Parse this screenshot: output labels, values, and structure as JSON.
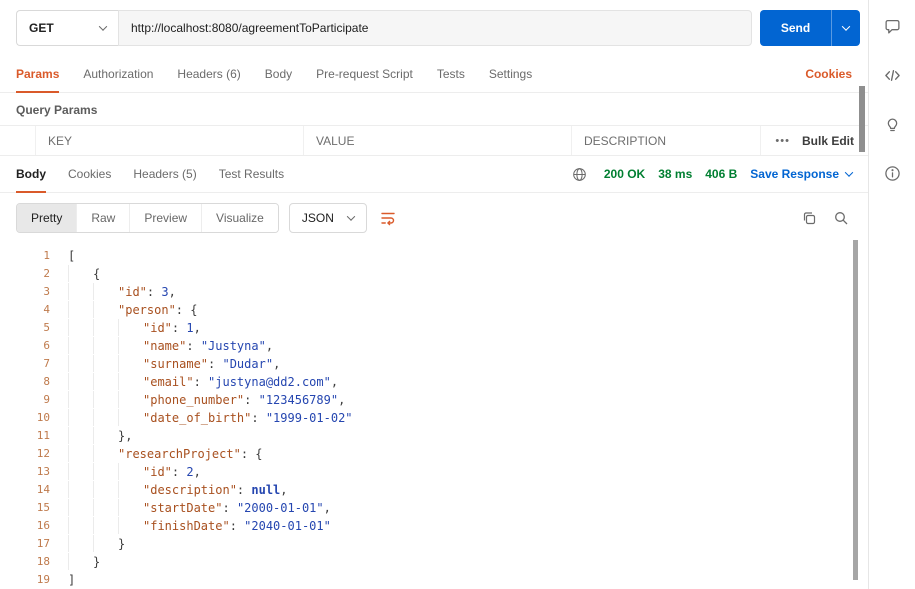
{
  "request": {
    "method": "GET",
    "url": "http://localhost:8080/agreementToParticipate",
    "send_label": "Send"
  },
  "request_tabs": [
    {
      "label": "Params",
      "active": true
    },
    {
      "label": "Authorization",
      "active": false
    },
    {
      "label": "Headers (6)",
      "active": false
    },
    {
      "label": "Body",
      "active": false
    },
    {
      "label": "Pre-request Script",
      "active": false
    },
    {
      "label": "Tests",
      "active": false
    },
    {
      "label": "Settings",
      "active": false
    }
  ],
  "cookies_link": "Cookies",
  "query_params": {
    "title": "Query Params",
    "columns": [
      "KEY",
      "VALUE",
      "DESCRIPTION"
    ],
    "more_label": "•••",
    "bulk_edit_label": "Bulk Edit"
  },
  "response": {
    "tabs": [
      {
        "label": "Body",
        "active": true
      },
      {
        "label": "Cookies",
        "active": false
      },
      {
        "label": "Headers (5)",
        "active": false
      },
      {
        "label": "Test Results",
        "active": false
      }
    ],
    "status": "200 OK",
    "time": "38 ms",
    "size": "406 B",
    "save_response_label": "Save Response",
    "view_tabs": [
      {
        "label": "Pretty",
        "active": true
      },
      {
        "label": "Raw",
        "active": false
      },
      {
        "label": "Preview",
        "active": false
      },
      {
        "label": "Visualize",
        "active": false
      }
    ],
    "format": "JSON",
    "code": {
      "lines": [
        {
          "n": 1,
          "indent": 0,
          "tokens": [
            [
              "p",
              "["
            ]
          ]
        },
        {
          "n": 2,
          "indent": 1,
          "tokens": [
            [
              "p",
              "{"
            ]
          ]
        },
        {
          "n": 3,
          "indent": 2,
          "tokens": [
            [
              "k",
              "\"id\""
            ],
            [
              "p",
              ": "
            ],
            [
              "v",
              "3"
            ],
            [
              "p",
              ","
            ]
          ]
        },
        {
          "n": 4,
          "indent": 2,
          "tokens": [
            [
              "k",
              "\"person\""
            ],
            [
              "p",
              ": {"
            ]
          ]
        },
        {
          "n": 5,
          "indent": 3,
          "tokens": [
            [
              "k",
              "\"id\""
            ],
            [
              "p",
              ": "
            ],
            [
              "v",
              "1"
            ],
            [
              "p",
              ","
            ]
          ]
        },
        {
          "n": 6,
          "indent": 3,
          "tokens": [
            [
              "k",
              "\"name\""
            ],
            [
              "p",
              ": "
            ],
            [
              "s",
              "\"Justyna\""
            ],
            [
              "p",
              ","
            ]
          ]
        },
        {
          "n": 7,
          "indent": 3,
          "tokens": [
            [
              "k",
              "\"surname\""
            ],
            [
              "p",
              ": "
            ],
            [
              "s",
              "\"Dudar\""
            ],
            [
              "p",
              ","
            ]
          ]
        },
        {
          "n": 8,
          "indent": 3,
          "tokens": [
            [
              "k",
              "\"email\""
            ],
            [
              "p",
              ": "
            ],
            [
              "s",
              "\"justyna@dd2.com\""
            ],
            [
              "p",
              ","
            ]
          ]
        },
        {
          "n": 9,
          "indent": 3,
          "tokens": [
            [
              "k",
              "\"phone_number\""
            ],
            [
              "p",
              ": "
            ],
            [
              "s",
              "\"123456789\""
            ],
            [
              "p",
              ","
            ]
          ]
        },
        {
          "n": 10,
          "indent": 3,
          "tokens": [
            [
              "k",
              "\"date_of_birth\""
            ],
            [
              "p",
              ": "
            ],
            [
              "s",
              "\"1999-01-02\""
            ]
          ]
        },
        {
          "n": 11,
          "indent": 2,
          "tokens": [
            [
              "p",
              "},"
            ]
          ]
        },
        {
          "n": 12,
          "indent": 2,
          "tokens": [
            [
              "k",
              "\"researchProject\""
            ],
            [
              "p",
              ": {"
            ]
          ]
        },
        {
          "n": 13,
          "indent": 3,
          "tokens": [
            [
              "k",
              "\"id\""
            ],
            [
              "p",
              ": "
            ],
            [
              "v",
              "2"
            ],
            [
              "p",
              ","
            ]
          ]
        },
        {
          "n": 14,
          "indent": 3,
          "tokens": [
            [
              "k",
              "\"description\""
            ],
            [
              "p",
              ": "
            ],
            [
              "n",
              "null"
            ],
            [
              "p",
              ","
            ]
          ]
        },
        {
          "n": 15,
          "indent": 3,
          "tokens": [
            [
              "k",
              "\"startDate\""
            ],
            [
              "p",
              ": "
            ],
            [
              "s",
              "\"2000-01-01\""
            ],
            [
              "p",
              ","
            ]
          ]
        },
        {
          "n": 16,
          "indent": 3,
          "tokens": [
            [
              "k",
              "\"finishDate\""
            ],
            [
              "p",
              ": "
            ],
            [
              "s",
              "\"2040-01-01\""
            ]
          ]
        },
        {
          "n": 17,
          "indent": 2,
          "tokens": [
            [
              "p",
              "}"
            ]
          ]
        },
        {
          "n": 18,
          "indent": 1,
          "tokens": [
            [
              "p",
              "}"
            ]
          ]
        },
        {
          "n": 19,
          "indent": 0,
          "tokens": [
            [
              "p",
              "]"
            ]
          ]
        }
      ]
    }
  },
  "icons": {
    "sidebar": [
      "comment-icon",
      "code-icon",
      "lightbulb-icon",
      "info-icon"
    ],
    "response_meta": "globe-icon",
    "view_toolbar": [
      "wrap-text-icon",
      "copy-icon",
      "search-icon"
    ],
    "params_row": "more-options-icon"
  },
  "colors": {
    "send_button_blue": "#0265D2",
    "link_blue": "#0265D2",
    "accent_orange": "#DA5A2A",
    "status_green": "#007F31",
    "json_key": "#A8501F",
    "json_value": "#2546B0",
    "line_number": "#BF7A4C"
  }
}
